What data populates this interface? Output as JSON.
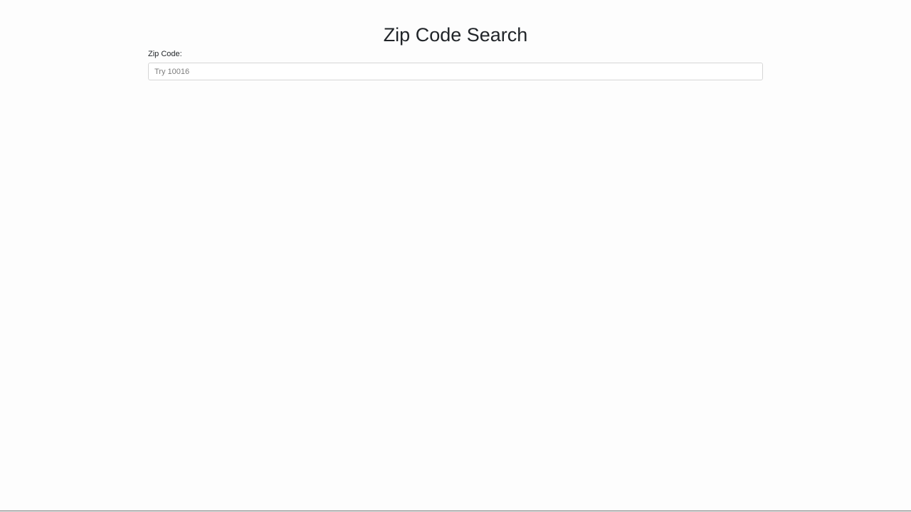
{
  "header": {
    "title": "Zip Code Search"
  },
  "form": {
    "zip_label": "Zip Code:",
    "zip_value": "",
    "zip_placeholder": "Try 10016"
  }
}
